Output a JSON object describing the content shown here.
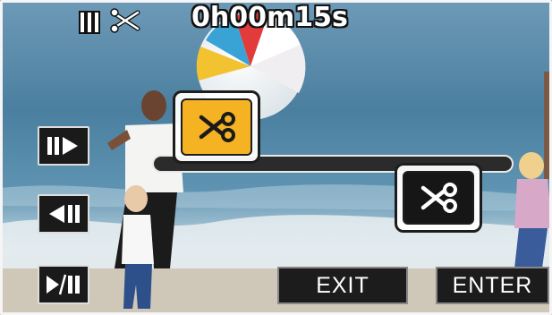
{
  "status": {
    "timecode": "0h00m15s",
    "mode_icon": "scissors-cut-mark-icon",
    "playback_state_icon": "pause-bars-icon"
  },
  "controls": {
    "frame_forward_icon": "step-forward-icon",
    "frame_back_icon": "step-back-icon",
    "play_pause_icon": "play-pause-icon"
  },
  "timeline": {
    "start_marker_icon": "scissors-icon",
    "end_marker_icon": "scissors-icon",
    "start_marker_state": "selected",
    "end_marker_state": "normal"
  },
  "buttons": {
    "exit_label": "EXIT",
    "enter_label": "ENTER"
  },
  "colors": {
    "selected_marker": "#f5b324",
    "button_bg": "#1c1c1c",
    "overlay_text": "#ffffff"
  }
}
